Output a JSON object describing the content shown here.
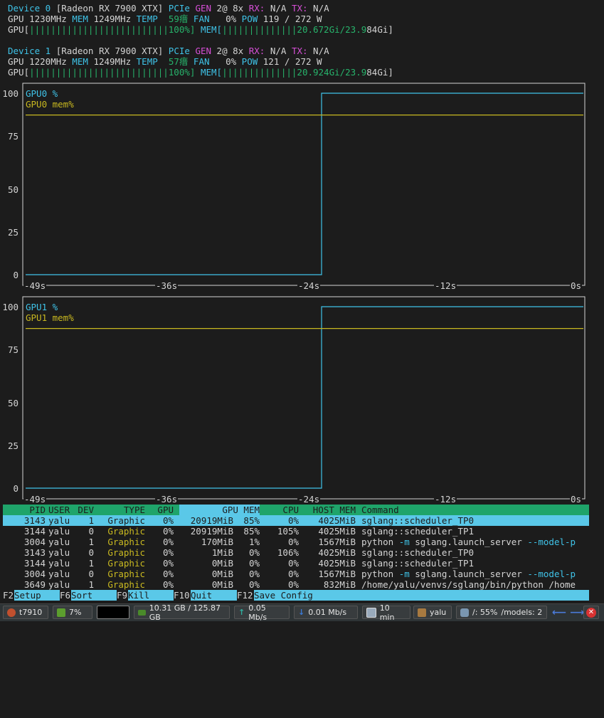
{
  "devices": [
    {
      "label": "Device 0",
      "name": "[Radeon RX 7900 XTX]",
      "pcie": "PCIe",
      "gen_label": "GEN",
      "gen_value": "2@ 8x",
      "rx_label": "RX:",
      "rx_value": "N/A",
      "tx_label": "TX:",
      "tx_value": "N/A",
      "gpu_label": "GPU",
      "gpu_clock": "1230MHz",
      "mem_label": "MEM",
      "mem_clock": "1249MHz",
      "temp_label": "TEMP",
      "temp_value": "59瘄",
      "fan_label": "FAN",
      "fan_value": "0%",
      "pow_label": "POW",
      "pow_value": "119 / 272 W",
      "gpu_bar_label": "GPU[",
      "gpu_bar_ticks": "||||||||||||||||||||||||||",
      "gpu_bar_value": "100%]",
      "mem_bar_label": "MEM[",
      "mem_bar_ticks": "||||||||||||||",
      "mem_bar_value": "20.672Gi/23.9",
      "mem_bar_value_tail": "84Gi]"
    },
    {
      "label": "Device 1",
      "name": "[Radeon RX 7900 XTX]",
      "pcie": "PCIe",
      "gen_label": "GEN",
      "gen_value": "2@ 8x",
      "rx_label": "RX:",
      "rx_value": "N/A",
      "tx_label": "TX:",
      "tx_value": "N/A",
      "gpu_label": "GPU",
      "gpu_clock": "1220MHz",
      "mem_label": "MEM",
      "mem_clock": "1249MHz",
      "temp_label": "TEMP",
      "temp_value": "57瘄",
      "fan_label": "FAN",
      "fan_value": "0%",
      "pow_label": "POW",
      "pow_value": "121 / 272 W",
      "gpu_bar_label": "GPU[",
      "gpu_bar_ticks": "||||||||||||||||||||||||||",
      "gpu_bar_value": "100%]",
      "mem_bar_label": "MEM[",
      "mem_bar_ticks": "||||||||||||||",
      "mem_bar_value": "20.924Gi/23.9",
      "mem_bar_value_tail": "84Gi]"
    }
  ],
  "chart_data": [
    {
      "type": "line",
      "y_ticks": [
        "100",
        "75",
        "50",
        "25",
        "0"
      ],
      "x_ticks": [
        "-49s",
        "-36s",
        "-24s",
        "-12s",
        "0s"
      ],
      "ylim": [
        0,
        100
      ],
      "xlim": [
        -49,
        0
      ],
      "series": [
        {
          "name": "GPU0 %",
          "color": "#3fc3e8",
          "x": [
            -49,
            -23,
            -23,
            0
          ],
          "y": [
            0,
            0,
            100,
            100
          ]
        },
        {
          "name": "GPU0 mem%",
          "color": "#c8b820",
          "x": [
            -49,
            0
          ],
          "y": [
            88,
            88
          ]
        }
      ]
    },
    {
      "type": "line",
      "y_ticks": [
        "100",
        "75",
        "50",
        "25",
        "0"
      ],
      "x_ticks": [
        "-49s",
        "-36s",
        "-24s",
        "-12s",
        "0s"
      ],
      "ylim": [
        0,
        100
      ],
      "xlim": [
        -49,
        0
      ],
      "series": [
        {
          "name": "GPU1 %",
          "color": "#3fc3e8",
          "x": [
            -49,
            -23,
            -23,
            0
          ],
          "y": [
            0,
            0,
            100,
            100
          ]
        },
        {
          "name": "GPU1 mem%",
          "color": "#c8b820",
          "x": [
            -49,
            0
          ],
          "y": [
            88,
            88
          ]
        }
      ]
    }
  ],
  "processes": {
    "headers": [
      "PID",
      "USER",
      "DEV",
      "TYPE",
      "GPU",
      "GPU MEM",
      "CPU",
      "HOST MEM",
      "Command"
    ],
    "rows": [
      {
        "pid": "3143",
        "user": "yalu",
        "dev": "1",
        "type": "Graphic",
        "gpu": "0%",
        "gpu_mem": "20919MiB",
        "mem_pct": "85%",
        "cpu": "0%",
        "host_mem": "4025MiB",
        "cmd_a": "sglang::scheduler_TP0",
        "cmd_flag": "",
        "cmd_b": ""
      },
      {
        "pid": "3144",
        "user": "yalu",
        "dev": "0",
        "type": "Graphic",
        "gpu": "0%",
        "gpu_mem": "20919MiB",
        "mem_pct": "85%",
        "cpu": "105%",
        "host_mem": "4025MiB",
        "cmd_a": "sglang::scheduler_TP1",
        "cmd_flag": "",
        "cmd_b": ""
      },
      {
        "pid": "3004",
        "user": "yalu",
        "dev": "1",
        "type": "Graphic",
        "gpu": "0%",
        "gpu_mem": "170MiB",
        "mem_pct": "1%",
        "cpu": "0%",
        "host_mem": "1567MiB",
        "cmd_a": "python ",
        "cmd_flag": "-m",
        "cmd_b": " sglang.launch_server --model-p"
      },
      {
        "pid": "3143",
        "user": "yalu",
        "dev": "0",
        "type": "Graphic",
        "gpu": "0%",
        "gpu_mem": "1MiB",
        "mem_pct": "0%",
        "cpu": "106%",
        "host_mem": "4025MiB",
        "cmd_a": "sglang::scheduler_TP0",
        "cmd_flag": "",
        "cmd_b": ""
      },
      {
        "pid": "3144",
        "user": "yalu",
        "dev": "1",
        "type": "Graphic",
        "gpu": "0%",
        "gpu_mem": "0MiB",
        "mem_pct": "0%",
        "cpu": "0%",
        "host_mem": "4025MiB",
        "cmd_a": "sglang::scheduler_TP1",
        "cmd_flag": "",
        "cmd_b": ""
      },
      {
        "pid": "3004",
        "user": "yalu",
        "dev": "0",
        "type": "Graphic",
        "gpu": "0%",
        "gpu_mem": "0MiB",
        "mem_pct": "0%",
        "cpu": "0%",
        "host_mem": "1567MiB",
        "cmd_a": "python ",
        "cmd_flag": "-m",
        "cmd_b": " sglang.launch_server --model-p"
      },
      {
        "pid": "3649",
        "user": "yalu",
        "dev": "1",
        "type": "Graphic",
        "gpu": "0%",
        "gpu_mem": "0MiB",
        "mem_pct": "0%",
        "cpu": "0%",
        "host_mem": "832MiB",
        "cmd_a": "/home/yalu/venvs/sglang/bin/python /home",
        "cmd_flag": "",
        "cmd_b": ""
      }
    ]
  },
  "function_keys": [
    {
      "key": "F2",
      "label": "Setup"
    },
    {
      "key": "F6",
      "label": "Sort"
    },
    {
      "key": "F9",
      "label": "Kill"
    },
    {
      "key": "F10",
      "label": "Quit"
    },
    {
      "key": "F12",
      "label": "Save Config"
    }
  ],
  "taskbar": {
    "host": "t7910",
    "cpu": "7%",
    "memory": "10.31 GB / 125.87 GB",
    "upload": "0.05 Mb/s",
    "download": "0.01 Mb/s",
    "uptime": "10 min",
    "user": "yalu",
    "disk_root": "/: 55%",
    "disk_models": "/models: 2"
  },
  "colors": {
    "background": "#1c1c1c",
    "cyan": "#3fc3e8",
    "magenta": "#d64fd6",
    "yellow": "#c8b820",
    "green": "#27b36b",
    "header_bg": "#1fa46a",
    "selection_bg": "#5ac8e8"
  }
}
